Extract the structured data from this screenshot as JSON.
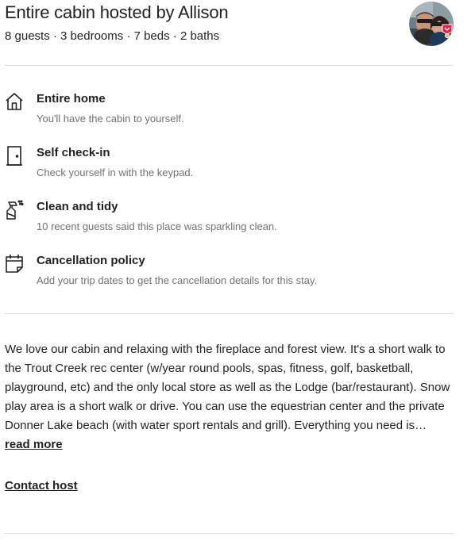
{
  "header": {
    "title": "Entire cabin hosted by Allison",
    "subtitle": "8 guests · 3 bedrooms · 7 beds · 2 baths",
    "avatar_icon": "host-avatar",
    "badge_icon": "superhost-badge-icon"
  },
  "highlights": [
    {
      "icon": "home-icon",
      "title": "Entire home",
      "subtitle": "You'll have the cabin to yourself."
    },
    {
      "icon": "door-icon",
      "title": "Self check-in",
      "subtitle": "Check yourself in with the keypad."
    },
    {
      "icon": "spray-bottle-icon",
      "title": "Clean and tidy",
      "subtitle": "10 recent guests said this place was sparkling clean."
    },
    {
      "icon": "calendar-icon",
      "title": "Cancellation policy",
      "subtitle": "Add your trip dates to get the cancellation details for this stay."
    }
  ],
  "description": {
    "text": "We love our cabin and relaxing with the fireplace and forest view. It's a short walk to the Trout Creek rec center (w/year round pools, spas, fitness, golf, basketball, playground, etc) and the only local store as well as the Lodge (bar/restaurant). Snow play area is a short walk or drive. You can use the equestrian center and the private Donner Lake beach (with water sport rentals and grill). Everything you need is… ",
    "read_more_label": "read more"
  },
  "contact_host_label": "Contact host"
}
